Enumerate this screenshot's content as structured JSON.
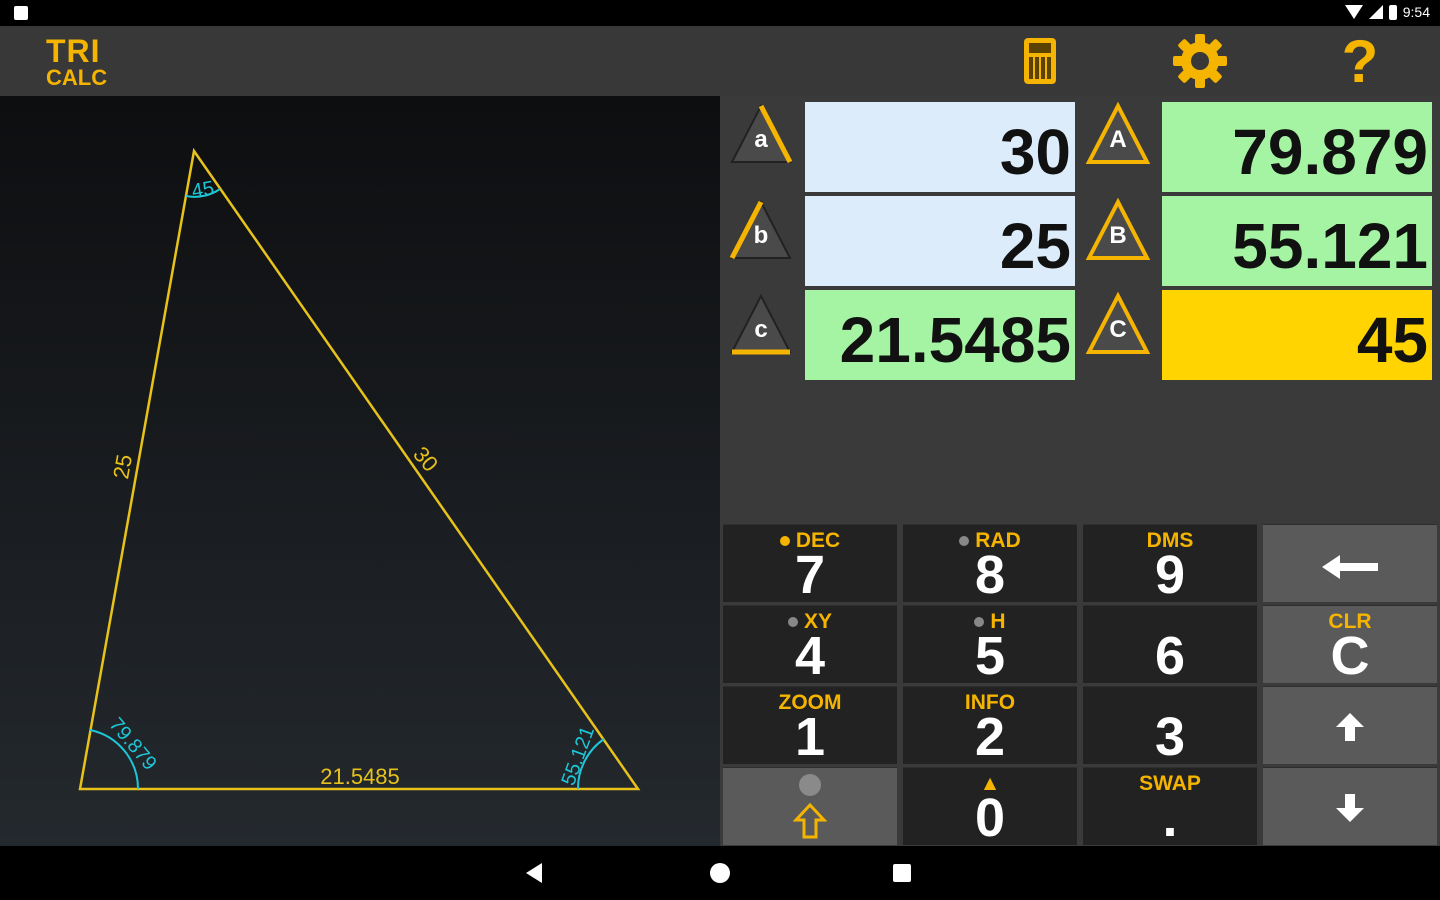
{
  "status": {
    "time": "9:54"
  },
  "app": {
    "logo_line1": "TRI",
    "logo_line2": "CALC",
    "help_label": "?"
  },
  "fields": {
    "a": {
      "letter": "a",
      "value": "30"
    },
    "b": {
      "letter": "b",
      "value": "25"
    },
    "c": {
      "letter": "c",
      "value": "21.5485"
    },
    "A": {
      "letter": "A",
      "value": "79.879"
    },
    "B": {
      "letter": "B",
      "value": "55.121"
    },
    "C": {
      "letter": "C",
      "value": "45"
    }
  },
  "diagram": {
    "side_a": "30",
    "side_b": "25",
    "side_c": "21.5485",
    "angle_A": "79.879",
    "angle_B": "55.121",
    "angle_C": "45"
  },
  "keypad": {
    "k7": {
      "top": "DEC",
      "main": "7"
    },
    "k8": {
      "top": "RAD",
      "main": "8"
    },
    "k9": {
      "top": "DMS",
      "main": "9"
    },
    "back": {
      "icon": "backspace-arrow"
    },
    "k4": {
      "top": "XY",
      "main": "4"
    },
    "k5": {
      "top": "H",
      "main": "5"
    },
    "k6": {
      "top": "",
      "main": "6"
    },
    "clr": {
      "top": "CLR",
      "main": "C"
    },
    "k1": {
      "top": "ZOOM",
      "main": "1"
    },
    "k2": {
      "top": "INFO",
      "main": "2"
    },
    "k3": {
      "top": "",
      "main": "3"
    },
    "up": {
      "icon": "arrow-up"
    },
    "shift": {
      "icon": "shift-arrow"
    },
    "k0": {
      "top": "▲",
      "main": "0"
    },
    "swap": {
      "top": "SWAP",
      "main": "."
    },
    "down": {
      "icon": "arrow-down"
    }
  },
  "colors": {
    "accent": "#f5b400",
    "input": "#dcecfa",
    "computed": "#a4f4a4",
    "selected": "#ffd400",
    "triangle": "#e6c21a",
    "angle": "#1dc6d6"
  }
}
